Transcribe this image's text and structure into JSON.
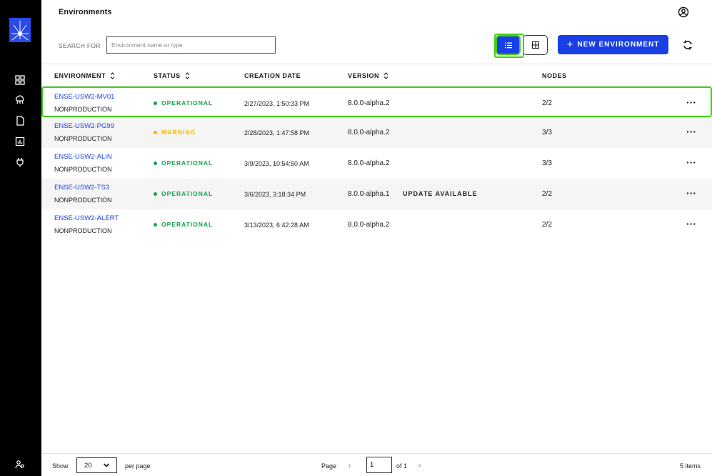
{
  "header": {
    "title": "Environments"
  },
  "nav": {
    "icons": [
      "dashboard-icon",
      "cloud-network-icon",
      "document-icon",
      "report-icon",
      "plug-icon"
    ],
    "bottom_icon": "users-icon"
  },
  "toolbar": {
    "search_label": "SEARCH FOR",
    "search_placeholder": "Environment name or type",
    "new_button_label": "NEW ENVIRONMENT",
    "new_button_plus": "+",
    "active_view": "list"
  },
  "table": {
    "columns": {
      "environment": "ENVIRONMENT",
      "status": "STATUS",
      "creation_date": "CREATION DATE",
      "version": "VERSION",
      "nodes": "NODES"
    },
    "rows": [
      {
        "name": "ENSE-USW2-MV01",
        "type": "NONPRODUCTION",
        "status": "OPERATIONAL",
        "status_color": "#16a34a",
        "date": "2/27/2023, 1:50:33 PM",
        "version": "8.0.0-alpha.2",
        "update": "",
        "nodes": "2/2"
      },
      {
        "name": "ENSE-USW2-PG99",
        "type": "NONPRODUCTION",
        "status": "WARNING",
        "status_color": "#f5b800",
        "date": "2/28/2023, 1:47:58 PM",
        "version": "8.0.0-alpha.2",
        "update": "",
        "nodes": "3/3"
      },
      {
        "name": "ENSE-USW2-ALIN",
        "type": "NONPRODUCTION",
        "status": "OPERATIONAL",
        "status_color": "#16a34a",
        "date": "3/9/2023, 10:54:50 AM",
        "version": "8.0.0-alpha.2",
        "update": "",
        "nodes": "3/3"
      },
      {
        "name": "ENSE-USW2-TS3",
        "type": "NONPRODUCTION",
        "status": "OPERATIONAL",
        "status_color": "#16a34a",
        "date": "3/6/2023, 3:18:34 PM",
        "version": "8.0.0-alpha.1",
        "update": "UPDATE AVAILABLE",
        "nodes": "2/2"
      },
      {
        "name": "ENSE-USW2-ALERT",
        "type": "NONPRODUCTION",
        "status": "OPERATIONAL",
        "status_color": "#16a34a",
        "date": "3/13/2023, 6:42:28 AM",
        "version": "8.0.0-alpha.2",
        "update": "",
        "nodes": "2/2"
      }
    ],
    "more_label": "···"
  },
  "footer": {
    "show_label": "Show",
    "per_page_value": "20",
    "per_page_label": "per page",
    "page_label": "Page",
    "page_value": "1",
    "of_label": "of 1",
    "items_label": "5 items"
  },
  "colors": {
    "accent": "#1a3fe6",
    "highlight": "#43d014",
    "operational": "#16a34a",
    "warning": "#f5b800"
  }
}
